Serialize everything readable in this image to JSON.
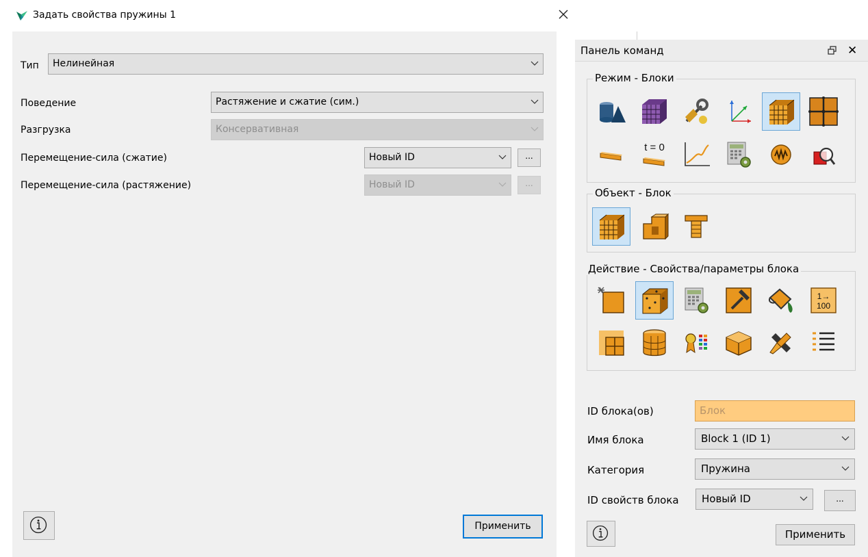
{
  "dialog": {
    "title": "Задать свойства пружины 1",
    "type_label": "Тип",
    "type_value": "Нелинейная",
    "behavior_label": "Поведение",
    "behavior_value": "Растяжение и сжатие (сим.)",
    "unload_label": "Разгрузка",
    "unload_value": "Консервативная",
    "disp_force_comp_label": "Перемещение-сила (сжатие)",
    "disp_force_comp_value": "Новый ID",
    "disp_force_tens_label": "Перемещение-сила (растяжение)",
    "disp_force_tens_value": "Новый ID",
    "dots": "...",
    "info_icon": "info-icon",
    "apply_label": "Применить"
  },
  "panel": {
    "title": "Панель команд",
    "mode_group": "Режим - Блоки",
    "object_group": "Объект - Блок",
    "action_group": "Действие - Свойства/параметры блока",
    "t0_text": "t = 0",
    "num_text_top": "1→",
    "num_text_bottom": "100",
    "block_ids_label": "ID блока(ов)",
    "block_ids_placeholder": "Блок",
    "block_name_label": "Имя блока",
    "block_name_value": "Block 1 (ID 1)",
    "category_label": "Категория",
    "category_value": "Пружина",
    "block_props_label": "ID свойств блока",
    "block_props_value": "Новый ID",
    "dots": "...",
    "apply_label": "Применить"
  },
  "colors": {
    "accent": "#0078d7",
    "selected_bg": "#cce4f7",
    "input_highlight": "#ffcc80",
    "icon_orange": "#e8961e",
    "icon_blue": "#1f4f7a"
  }
}
